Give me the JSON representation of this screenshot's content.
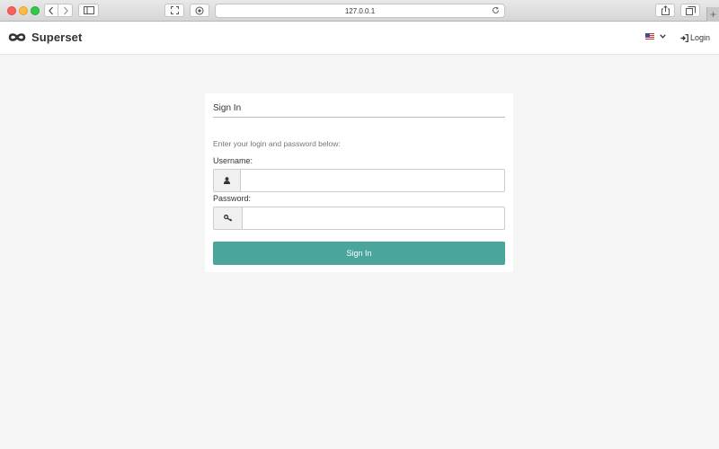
{
  "browser": {
    "url": "127.0.0.1",
    "icons": {
      "back": "chevron-left-icon",
      "forward": "chevron-right-icon",
      "sidebar": "sidebar-icon",
      "fullscreen": "fullscreen-icon",
      "privacy": "privacy-icon",
      "reload": "reload-icon",
      "share": "share-icon",
      "tabs": "tabs-icon",
      "new_tab": "plus-icon"
    },
    "new_tab_label": "+"
  },
  "navbar": {
    "brand": "Superset",
    "brand_icon": "infinity-logo-icon",
    "language_icon": "us-flag-icon",
    "login_label": "Login",
    "login_icon": "sign-in-icon"
  },
  "signin": {
    "title": "Sign In",
    "hint": "Enter your login and password below:",
    "username_label": "Username:",
    "username_value": "",
    "username_icon": "user-icon",
    "password_label": "Password:",
    "password_value": "",
    "password_icon": "key-icon",
    "submit_label": "Sign In"
  },
  "colors": {
    "primary": "#4aa69c",
    "background": "#f5f5f5",
    "text": "#333333"
  }
}
